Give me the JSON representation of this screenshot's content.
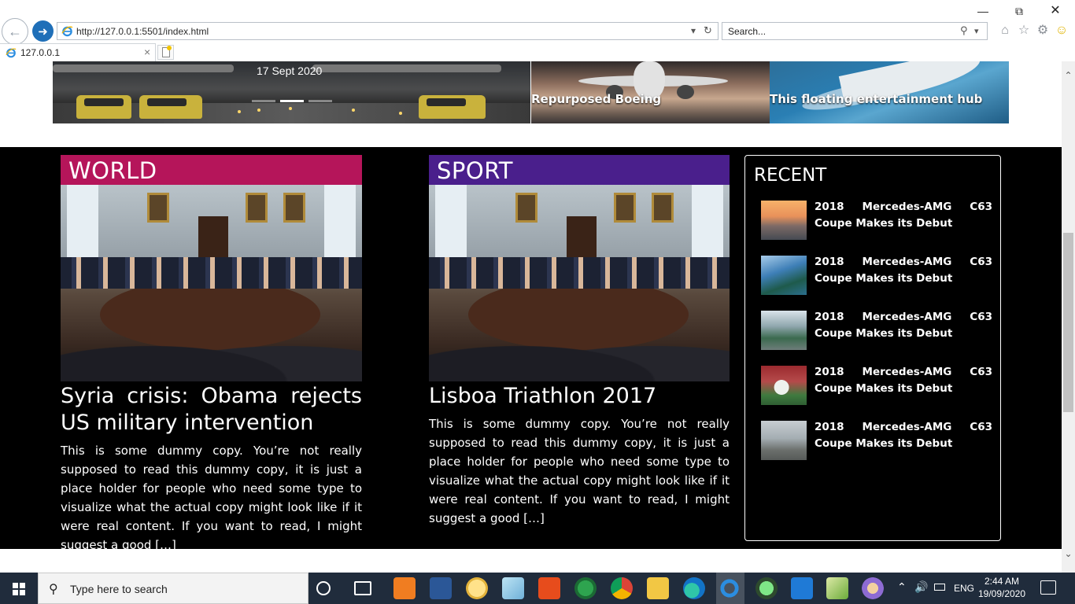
{
  "browser": {
    "url": "http://127.0.0.1:5501/index.html",
    "search_placeholder": "Search...",
    "tab_title": "127.0.0.1",
    "tab_close": "×"
  },
  "slider": {
    "date": "17 Sept 2020",
    "side_slides": [
      {
        "caption": "Repurposed Boeing"
      },
      {
        "caption": "This floating entertainment hub"
      }
    ],
    "active_dot": 2,
    "dot_count": 3
  },
  "cards": [
    {
      "category": "WORLD",
      "color": "#b5155a",
      "title": "Syria crisis: Obama rejects US military intervention",
      "body": "This is some dummy copy. You’re not really supposed to read this dummy copy, it is just a place holder for people who need some type to visualize what the actual copy might look like if it were real content. If you want to read, I might suggest a good […]"
    },
    {
      "category": "SPORT",
      "color": "#4a1f8c",
      "title": "Lisboa Triathlon 2017",
      "body": "This is some dummy copy. You’re not really supposed to read this dummy copy, it is just a place holder for people who need some type to visualize what the actual copy might look like if it were real content. If you want to read, I might suggest a good […]"
    }
  ],
  "recent": {
    "title": "RECENT",
    "items": [
      {
        "text": "2018 Mercedes-AMG C63 Coupe Makes its Debut",
        "thumb": "sunset-car"
      },
      {
        "text": "2018 Mercedes-AMG C63 Coupe Makes its Debut",
        "thumb": "fjord"
      },
      {
        "text": "2018 Mercedes-AMG C63 Coupe Makes its Debut",
        "thumb": "race-finish"
      },
      {
        "text": "2018 Mercedes-AMG C63 Coupe Makes its Debut",
        "thumb": "stadium-flare"
      },
      {
        "text": "2018 Mercedes-AMG C63 Coupe Makes its Debut",
        "thumb": "palace"
      }
    ]
  },
  "taskbar": {
    "search_placeholder": "Type here to search",
    "language": "ENG",
    "time": "2:44 AM",
    "date": "19/09/2020"
  }
}
